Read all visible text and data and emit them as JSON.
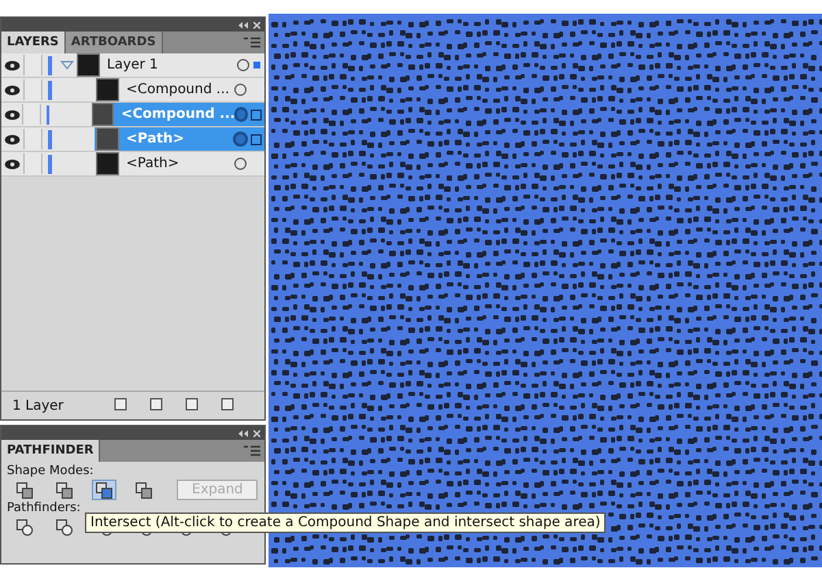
{
  "layers_panel": {
    "tabs": [
      {
        "label": "LAYERS",
        "selected": true
      },
      {
        "label": "ARTBOARDS",
        "selected": false
      }
    ],
    "layers": [
      {
        "name": "Layer 1",
        "expanded": true,
        "selected": false,
        "children": [
          {
            "name": "<Compound ...",
            "selected": false
          },
          {
            "name": "<Compound ...",
            "selected": true
          },
          {
            "name": "<Path>",
            "selected": true
          },
          {
            "name": "<Path>",
            "selected": false
          }
        ]
      }
    ],
    "status": "1 Layer"
  },
  "pathfinder_panel": {
    "tabs": [
      {
        "label": "PATHFINDER",
        "selected": true
      }
    ],
    "shape_modes_label": "Shape Modes:",
    "shape_modes": [
      {
        "selected": false
      },
      {
        "selected": false
      },
      {
        "selected": true
      },
      {
        "selected": false
      }
    ],
    "expand_button": {
      "label": "Expand",
      "disabled": true
    },
    "pathfinders_label": "Pathfinders:",
    "pathfinders": [
      {
        "selected": false
      },
      {
        "selected": false
      },
      {
        "selected": false
      },
      {
        "selected": false
      },
      {
        "selected": false
      },
      {
        "selected": false
      }
    ],
    "tooltip": "Intersect (Alt-click to create a Compound Shape and intersect shape area)"
  }
}
